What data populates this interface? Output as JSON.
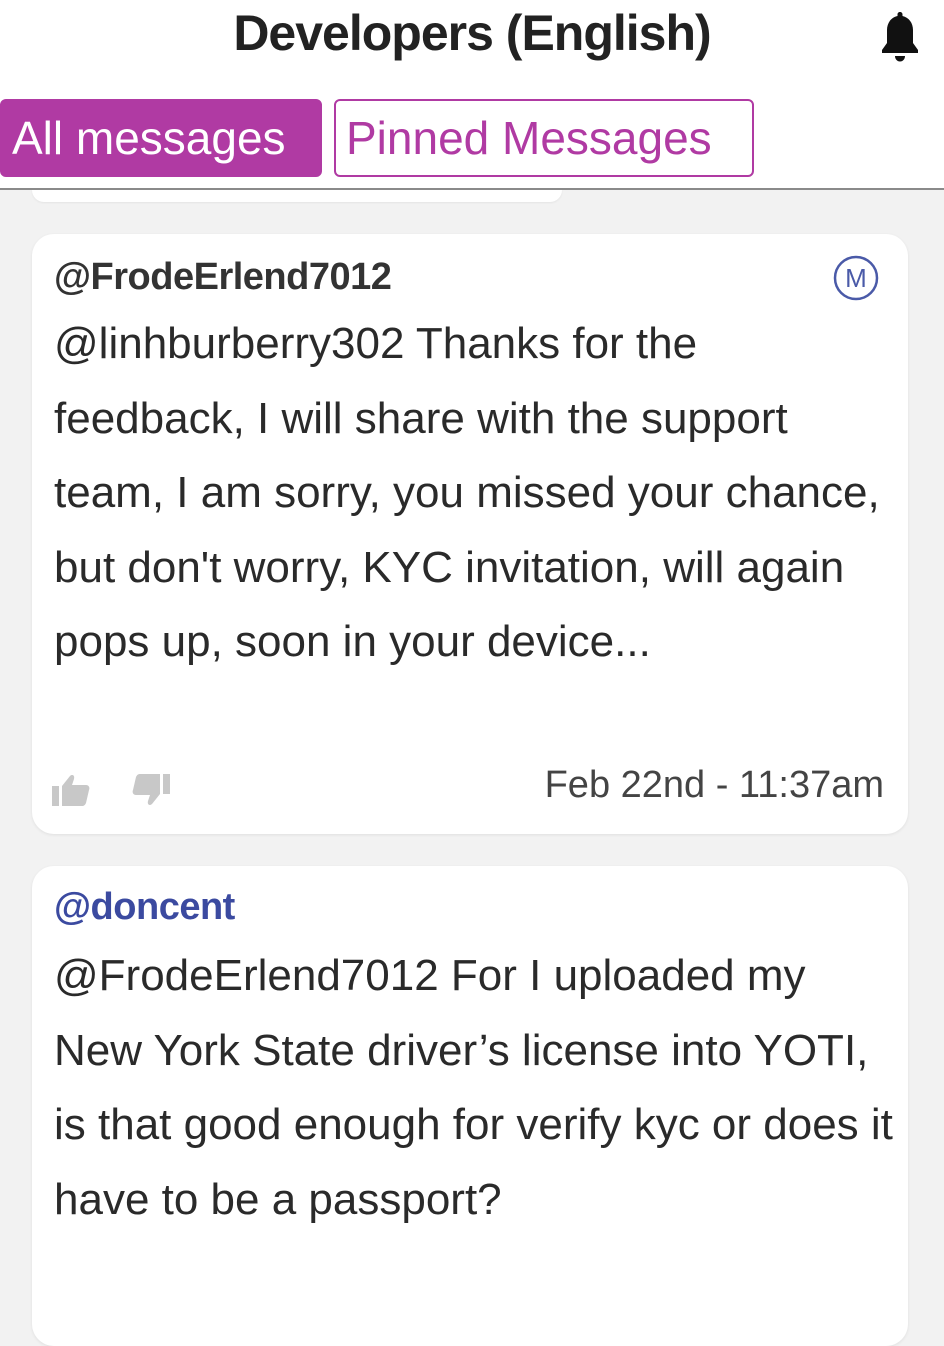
{
  "header": {
    "title": "Developers (English)",
    "bell_icon": "bell-icon"
  },
  "tabs": {
    "all_label": "All messages",
    "pinned_label": "Pinned Messages"
  },
  "colors": {
    "accent": "#b03aa3",
    "mention_author": "#3b4aa0"
  },
  "messages": [
    {
      "author": "@FrodeErlend7012",
      "badge": "M",
      "text": "@linhburberry302 Thanks for the feedback, I will share with the support team, I am sorry, you missed your chance, but don't worry, KYC invitation, will again pops up, soon in your device...",
      "timestamp": "Feb 22nd - 11:37am"
    },
    {
      "author": "@doncent",
      "text": "@FrodeErlend7012 For I uploaded my New York State driver’s license into YOTI, is that good enough for verify kyc or does it have to be a passport?"
    }
  ]
}
